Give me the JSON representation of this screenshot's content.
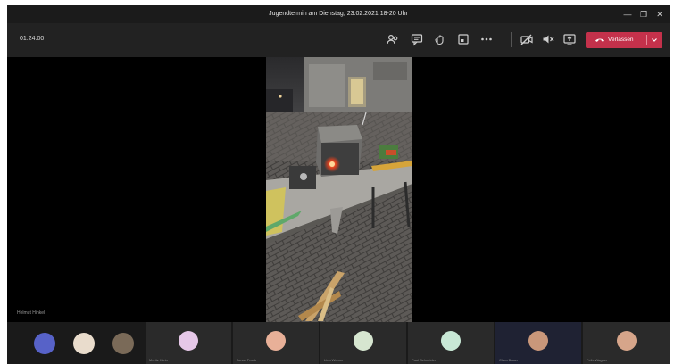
{
  "window": {
    "title": "Jugendtermin am Dienstag, 23.02.2021 18-20 Uhr",
    "controls": {
      "minimize": "—",
      "maximize": "❐",
      "close": "✕"
    }
  },
  "toolbar": {
    "timer": "01:24:00",
    "icons": [
      "participants-icon",
      "chat-icon",
      "raise-hand-icon",
      "breakout-rooms-icon",
      "more-actions-icon",
      "camera-off-icon",
      "mute-icon",
      "share-screen-icon"
    ],
    "leave_label": "Verlassen",
    "leave_color": "#c4314b"
  },
  "stage": {
    "speaker_name": "Helmut Hinkel"
  },
  "participants": {
    "tiles": [
      {
        "name": "Moritz Klein",
        "color": "#e6c8e8"
      },
      {
        "name": "Jonas Frank",
        "color": "#e8b098"
      },
      {
        "name": "Lina Werner",
        "color": "#d6e6d0"
      },
      {
        "name": "Paul Schneider",
        "color": "#c8e8d6"
      },
      {
        "name": "Clara Bauer",
        "color": "#c9977a"
      },
      {
        "name": "Felix Wagner",
        "color": "#d6a58a"
      }
    ]
  }
}
